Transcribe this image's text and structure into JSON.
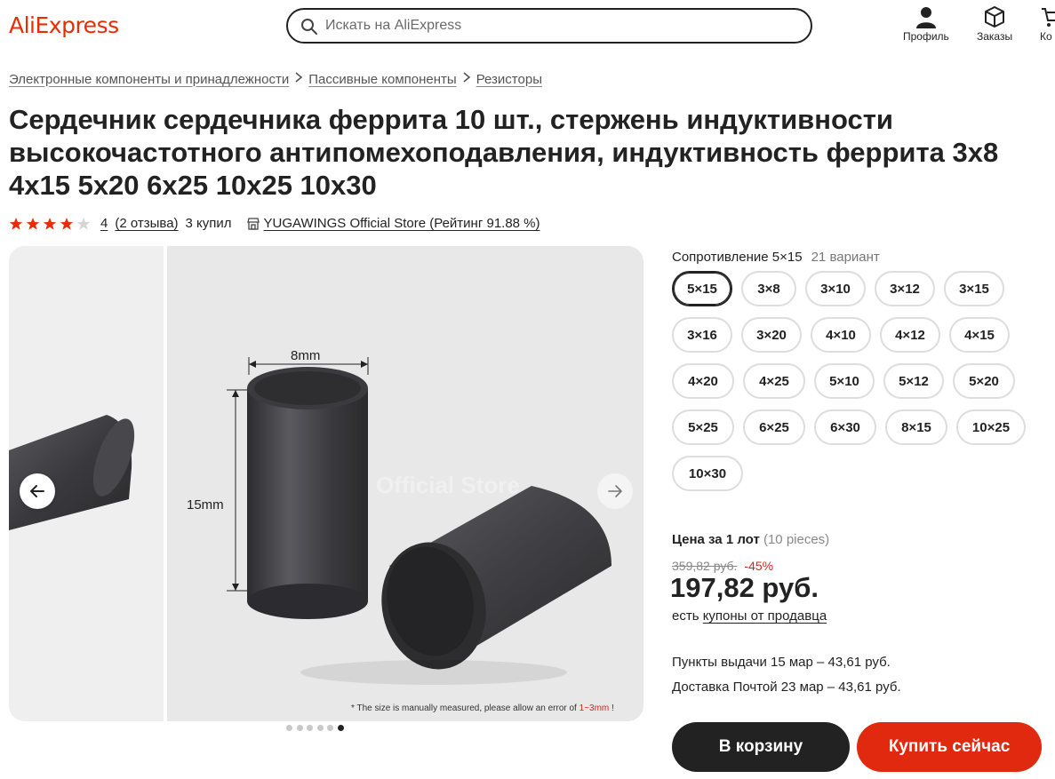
{
  "header": {
    "logo": "AliExpress",
    "search_placeholder": "Искать на AliExpress",
    "profile_label": "Профиль",
    "orders_label": "Заказы",
    "cart_label": "Ко"
  },
  "breadcrumb": [
    "Электронные компоненты и принадлежности",
    "Пассивные компоненты",
    "Резисторы"
  ],
  "title": "Сердечник сердечника феррита 10 шт., стержень индуктивности высокочастотного антипомехоподавления, индуктивность феррита 3x8 4x15 5x20 6x25 10x25 10x30",
  "rating": {
    "stars": 4,
    "max_stars": 5,
    "value": "4",
    "reviews": "(2 отзыва)",
    "sold": "3 купил",
    "store": "YUGAWINGS Official Store (Рейтинг 91.88 %)"
  },
  "gallery": {
    "image_labels": {
      "width": "8mm",
      "height": "15mm",
      "watermark": "Official Store"
    },
    "note_prefix": "* The size is manually measured, please allow an error of ",
    "note_highlight": "1~3mm",
    "note_suffix": " !",
    "dots_total": 6,
    "dots_active_index": 5,
    "prev_icon": "arrow-left-icon",
    "next_icon": "arrow-right-icon"
  },
  "variant": {
    "label": "Сопротивление 5×15",
    "count": "21 вариант",
    "rows": [
      [
        "5×15",
        "3×8",
        "3×10",
        "3×12",
        "3×15"
      ],
      [
        "3×16",
        "3×20",
        "4×10",
        "4×12",
        "4×15"
      ],
      [
        "4×20",
        "4×25",
        "5×10",
        "5×12",
        "5×20"
      ],
      [
        "5×25",
        "6×25",
        "6×30",
        "8×15",
        "10×25"
      ],
      [
        "10×30"
      ]
    ],
    "selected": "5×15"
  },
  "price": {
    "label": "Цена за 1 лот",
    "lot_note": "(10 pieces)",
    "old_price": "359,82 руб.",
    "discount": "-45%",
    "current": "197,82 руб.",
    "coupons_prefix": "есть ",
    "coupons_link": "купоны от продавца"
  },
  "delivery": {
    "pickup": "Пункты выдачи 15 мар – 43,61 руб.",
    "post": "Доставка Почтой 23 мар – 43,61 руб."
  },
  "buttons": {
    "cart": "В корзину",
    "buy": "Купить сейчас"
  },
  "colors": {
    "brand": "#e62e04",
    "buy_button": "#e0290f",
    "cart_button": "#222222",
    "star": "#e62e04",
    "discount": "#d4241c"
  }
}
